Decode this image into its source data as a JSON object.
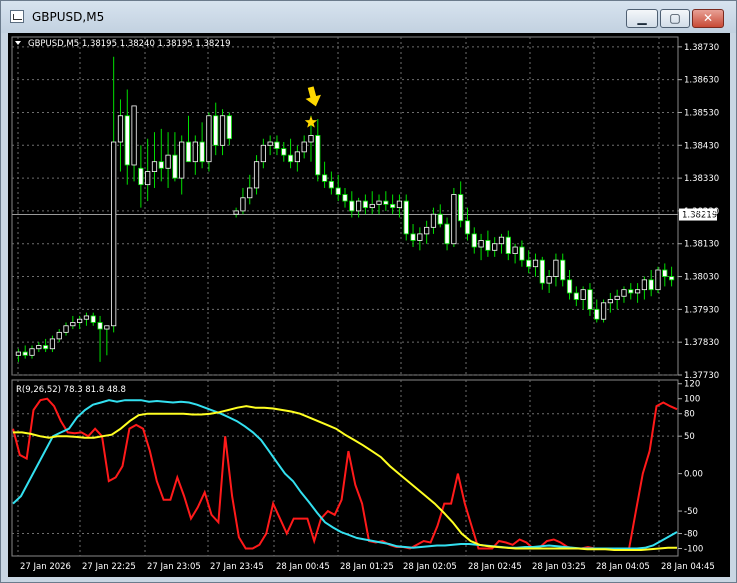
{
  "window": {
    "title": "GBPUSD,M5",
    "minimize_glyph": "▁",
    "maximize_glyph": "▢",
    "close_glyph": "✕"
  },
  "colors": {
    "background": "#000000",
    "grid": "#6e6e6e",
    "bull": "#ffffff",
    "bear": "#ffffff",
    "wick": "#00e000",
    "rsi_red": "#ff1a1a",
    "rsi_cyan": "#33e0f0",
    "rsi_yellow": "#ffff22",
    "arrow": "#ffd800"
  },
  "symbol_header": "GBPUSD,M5  1.38195 1.38240 1.38195 1.38219",
  "price_axis": [
    "1.38730",
    "1.38630",
    "1.38530",
    "1.38430",
    "1.38330",
    "1.38230",
    "1.38130",
    "1.38030",
    "1.37930",
    "1.37830",
    "1.37730"
  ],
  "current_price": "1.38219",
  "indicator": {
    "header": "R(9,26,52) 78.3 81.8 48.8",
    "axis_labels": [
      "120",
      "100",
      "80",
      "50",
      "0.00",
      "-50",
      "-80",
      "-100"
    ]
  },
  "time_axis": [
    "27 Jan 2026",
    "27 Jan 22:25",
    "27 Jan 23:05",
    "27 Jan 23:45",
    "28 Jan 00:45",
    "28 Jan 01:25",
    "28 Jan 02:05",
    "28 Jan 02:45",
    "28 Jan 03:25",
    "28 Jan 04:05",
    "28 Jan 04:45"
  ],
  "chart_data": [
    {
      "type": "candlestick",
      "symbol": "GBPUSD",
      "timeframe": "M5",
      "ylim": [
        1.3773,
        1.3876
      ],
      "last_price": 1.38219,
      "candles": [
        [
          1.3779,
          1.3781,
          1.3777,
          1.378
        ],
        [
          1.378,
          1.3782,
          1.3778,
          1.3779
        ],
        [
          1.3779,
          1.3782,
          1.3778,
          1.3781
        ],
        [
          1.3781,
          1.3783,
          1.378,
          1.3782
        ],
        [
          1.3782,
          1.3784,
          1.378,
          1.3781
        ],
        [
          1.3781,
          1.3785,
          1.378,
          1.3784
        ],
        [
          1.3784,
          1.3787,
          1.3783,
          1.3786
        ],
        [
          1.3786,
          1.3789,
          1.3785,
          1.3788
        ],
        [
          1.3788,
          1.3791,
          1.3787,
          1.3789
        ],
        [
          1.3789,
          1.3791,
          1.3787,
          1.379
        ],
        [
          1.379,
          1.3792,
          1.3788,
          1.3791
        ],
        [
          1.3791,
          1.3792,
          1.3788,
          1.3789
        ],
        [
          1.3789,
          1.3791,
          1.3777,
          1.3787
        ],
        [
          1.3787,
          1.3788,
          1.3779,
          1.3788
        ],
        [
          1.3788,
          1.387,
          1.3786,
          1.3844
        ],
        [
          1.3844,
          1.3857,
          1.3835,
          1.3852
        ],
        [
          1.3852,
          1.386,
          1.3831,
          1.3837
        ],
        [
          1.3837,
          1.3854,
          1.3832,
          1.3855
        ],
        [
          1.3836,
          1.3843,
          1.3824,
          1.3831
        ],
        [
          1.3831,
          1.3845,
          1.3826,
          1.3835
        ],
        [
          1.3835,
          1.3847,
          1.383,
          1.3838
        ],
        [
          1.3838,
          1.3848,
          1.3832,
          1.3836
        ],
        [
          1.3836,
          1.3847,
          1.383,
          1.384
        ],
        [
          1.384,
          1.3847,
          1.3832,
          1.3833
        ],
        [
          1.3833,
          1.3846,
          1.3828,
          1.3844
        ],
        [
          1.3844,
          1.3852,
          1.3838,
          1.3838
        ],
        [
          1.3838,
          1.3846,
          1.3834,
          1.3844
        ],
        [
          1.3844,
          1.385,
          1.3836,
          1.3838
        ],
        [
          1.3838,
          1.3853,
          1.3835,
          1.3852
        ],
        [
          1.3852,
          1.3856,
          1.384,
          1.3843
        ],
        [
          1.3843,
          1.3854,
          1.384,
          1.3852
        ],
        [
          1.3852,
          1.3853,
          1.3843,
          1.3845
        ],
        [
          1.3822,
          1.3824,
          1.3821,
          1.3823
        ],
        [
          1.3823,
          1.383,
          1.3822,
          1.3827
        ],
        [
          1.3827,
          1.3834,
          1.3825,
          1.383
        ],
        [
          1.383,
          1.384,
          1.3828,
          1.3838
        ],
        [
          1.3838,
          1.3845,
          1.3836,
          1.3843
        ],
        [
          1.3843,
          1.3846,
          1.384,
          1.3844
        ],
        [
          1.3844,
          1.3846,
          1.384,
          1.3842
        ],
        [
          1.3842,
          1.3844,
          1.3838,
          1.384
        ],
        [
          1.384,
          1.3845,
          1.3836,
          1.3838
        ],
        [
          1.3838,
          1.3843,
          1.3835,
          1.3841
        ],
        [
          1.3841,
          1.3846,
          1.3839,
          1.3844
        ],
        [
          1.3844,
          1.3852,
          1.3838,
          1.3846
        ],
        [
          1.3846,
          1.3851,
          1.3832,
          1.3834
        ],
        [
          1.3834,
          1.3838,
          1.383,
          1.3832
        ],
        [
          1.3832,
          1.3835,
          1.3828,
          1.383
        ],
        [
          1.383,
          1.3834,
          1.3826,
          1.3828
        ],
        [
          1.3828,
          1.383,
          1.3824,
          1.3826
        ],
        [
          1.3826,
          1.3829,
          1.3821,
          1.3823
        ],
        [
          1.3823,
          1.3827,
          1.3821,
          1.3826
        ],
        [
          1.3826,
          1.3828,
          1.3822,
          1.3824
        ],
        [
          1.3824,
          1.3829,
          1.3822,
          1.3825
        ],
        [
          1.3825,
          1.3828,
          1.3822,
          1.3826
        ],
        [
          1.3826,
          1.3829,
          1.3823,
          1.3825
        ],
        [
          1.3825,
          1.3828,
          1.3822,
          1.3824
        ],
        [
          1.3824,
          1.3828,
          1.3821,
          1.3826
        ],
        [
          1.3826,
          1.3828,
          1.3814,
          1.3816
        ],
        [
          1.3816,
          1.3819,
          1.3812,
          1.3814
        ],
        [
          1.3814,
          1.3818,
          1.3811,
          1.3816
        ],
        [
          1.3816,
          1.382,
          1.3813,
          1.3818
        ],
        [
          1.3818,
          1.3824,
          1.3816,
          1.3822
        ],
        [
          1.3822,
          1.3825,
          1.3818,
          1.3819
        ],
        [
          1.3819,
          1.3821,
          1.3811,
          1.3813
        ],
        [
          1.3813,
          1.383,
          1.3812,
          1.3828
        ],
        [
          1.3828,
          1.3832,
          1.3818,
          1.382
        ],
        [
          1.382,
          1.3824,
          1.3814,
          1.3816
        ],
        [
          1.3816,
          1.3818,
          1.381,
          1.3812
        ],
        [
          1.3812,
          1.3816,
          1.3808,
          1.3814
        ],
        [
          1.3814,
          1.3817,
          1.3809,
          1.3811
        ],
        [
          1.3811,
          1.3815,
          1.3809,
          1.3813
        ],
        [
          1.3813,
          1.3816,
          1.381,
          1.3815
        ],
        [
          1.3815,
          1.3817,
          1.3808,
          1.381
        ],
        [
          1.381,
          1.3813,
          1.3807,
          1.3812
        ],
        [
          1.3812,
          1.3814,
          1.3806,
          1.3808
        ],
        [
          1.3808,
          1.3811,
          1.3804,
          1.3806
        ],
        [
          1.3806,
          1.381,
          1.3803,
          1.3808
        ],
        [
          1.3808,
          1.3809,
          1.3799,
          1.3801
        ],
        [
          1.3801,
          1.3805,
          1.3798,
          1.3803
        ],
        [
          1.3803,
          1.381,
          1.38,
          1.3808
        ],
        [
          1.3808,
          1.381,
          1.38,
          1.3802
        ],
        [
          1.3802,
          1.3805,
          1.3796,
          1.3798
        ],
        [
          1.3798,
          1.38,
          1.3794,
          1.3796
        ],
        [
          1.3796,
          1.38,
          1.3793,
          1.3799
        ],
        [
          1.3799,
          1.3801,
          1.3791,
          1.3793
        ],
        [
          1.3793,
          1.3796,
          1.3789,
          1.379
        ],
        [
          1.379,
          1.3796,
          1.3789,
          1.3795
        ],
        [
          1.3795,
          1.3798,
          1.3792,
          1.3796
        ],
        [
          1.3796,
          1.3799,
          1.3793,
          1.3797
        ],
        [
          1.3797,
          1.38,
          1.3795,
          1.3799
        ],
        [
          1.3799,
          1.3801,
          1.3796,
          1.3798
        ],
        [
          1.3798,
          1.3801,
          1.3795,
          1.3799
        ],
        [
          1.3799,
          1.3803,
          1.3796,
          1.3802
        ],
        [
          1.3802,
          1.3805,
          1.3797,
          1.3799
        ],
        [
          1.3799,
          1.3806,
          1.3798,
          1.3805
        ],
        [
          1.3805,
          1.3807,
          1.38,
          1.3803
        ],
        [
          1.3803,
          1.3806,
          1.38,
          1.3802
        ]
      ],
      "markers": [
        {
          "type": "arrow-down",
          "price": 1.3855,
          "candle": 44
        },
        {
          "type": "star",
          "price": 1.385,
          "candle": 43
        }
      ]
    },
    {
      "type": "line",
      "title": "R(9,26,52) 78.3 81.8 48.8",
      "ylim": [
        -110,
        125
      ],
      "ticks": [
        120,
        100,
        80,
        50,
        0,
        -50,
        -80,
        -100
      ],
      "series": [
        {
          "color": "#ff1a1a",
          "values": [
            60,
            25,
            20,
            85,
            98,
            100,
            90,
            70,
            55,
            54,
            55,
            50,
            60,
            50,
            -10,
            -5,
            10,
            60,
            65,
            60,
            30,
            -10,
            -35,
            -35,
            -5,
            -30,
            -60,
            -45,
            -25,
            -55,
            -65,
            50,
            -30,
            -85,
            -100,
            -100,
            -95,
            -80,
            -40,
            -60,
            -80,
            -60,
            -60,
            -60,
            -90,
            -60,
            -50,
            -55,
            -35,
            30,
            -15,
            -40,
            -90,
            -92,
            -90,
            -95,
            -98,
            -98,
            -100,
            -95,
            -90,
            -92,
            -70,
            -40,
            -40,
            0,
            -40,
            -70,
            -100,
            -100,
            -100,
            -90,
            -92,
            -95,
            -88,
            -92,
            -100,
            -98,
            -90,
            -88,
            -92,
            -98,
            -100,
            -100,
            -98,
            -100,
            -100,
            -100,
            -100,
            -100,
            -100,
            -50,
            0,
            30,
            90,
            95,
            90,
            86
          ]
        },
        {
          "color": "#33e0f0",
          "values": [
            -40,
            -30,
            -10,
            10,
            30,
            50,
            55,
            60,
            75,
            85,
            92,
            95,
            98,
            96,
            98,
            98,
            98,
            96,
            97,
            96,
            95,
            96,
            95,
            92,
            88,
            84,
            80,
            75,
            70,
            63,
            55,
            45,
            30,
            15,
            0,
            -10,
            -25,
            -38,
            -52,
            -65,
            -72,
            -78,
            -82,
            -86,
            -88,
            -90,
            -92,
            -94,
            -97,
            -98,
            -99,
            -98,
            -97,
            -96,
            -96,
            -95,
            -94,
            -94,
            -95,
            -96,
            -97,
            -98,
            -99,
            -99,
            -98,
            -98,
            -97,
            -96,
            -97,
            -98,
            -99,
            -100,
            -100,
            -100,
            -100,
            -100,
            -100,
            -100,
            -100,
            -99,
            -96,
            -90,
            -84,
            -78
          ]
        },
        {
          "color": "#ffff22",
          "values": [
            55,
            55,
            53,
            50,
            48,
            50,
            50,
            49,
            48,
            48,
            50,
            52,
            60,
            70,
            78,
            80,
            80,
            80,
            80,
            80,
            79,
            79,
            80,
            82,
            85,
            88,
            90,
            88,
            88,
            87,
            85,
            83,
            80,
            75,
            70,
            65,
            60,
            52,
            45,
            38,
            30,
            22,
            10,
            0,
            -10,
            -20,
            -30,
            -40,
            -52,
            -65,
            -80,
            -90,
            -95,
            -97,
            -98,
            -99,
            -100,
            -100,
            -100,
            -100,
            -100,
            -100,
            -100,
            -100,
            -101,
            -101,
            -101,
            -102,
            -102,
            -102,
            -102,
            -101,
            -100,
            -99,
            -99
          ]
        }
      ]
    }
  ]
}
